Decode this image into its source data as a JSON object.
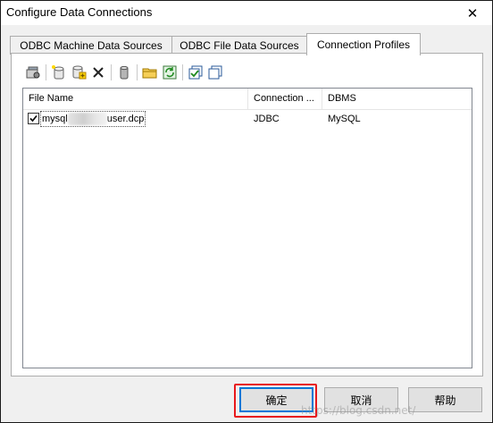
{
  "window": {
    "title": "Configure Data Connections",
    "close_glyph": "✕"
  },
  "tabs": [
    {
      "label": "ODBC Machine Data Sources",
      "active": false
    },
    {
      "label": "ODBC File Data Sources",
      "active": false
    },
    {
      "label": "Connection Profiles",
      "active": true
    }
  ],
  "toolbar": {
    "icons": [
      "properties-icon",
      "new-profile-icon",
      "add-profile-icon",
      "delete-icon",
      "database-icon",
      "open-folder-icon",
      "refresh-icon",
      "select-all-icon",
      "copy-icon"
    ]
  },
  "list": {
    "columns": [
      "File Name",
      "Connection ...",
      "DBMS"
    ],
    "rows": [
      {
        "checked": true,
        "file_prefix": "mysql",
        "file_suffix": "user.dcp",
        "connection": "JDBC",
        "dbms": "MySQL"
      }
    ]
  },
  "buttons": {
    "ok": "确定",
    "cancel": "取消",
    "help": "帮助"
  },
  "watermark": "https://blog.csdn.net/"
}
